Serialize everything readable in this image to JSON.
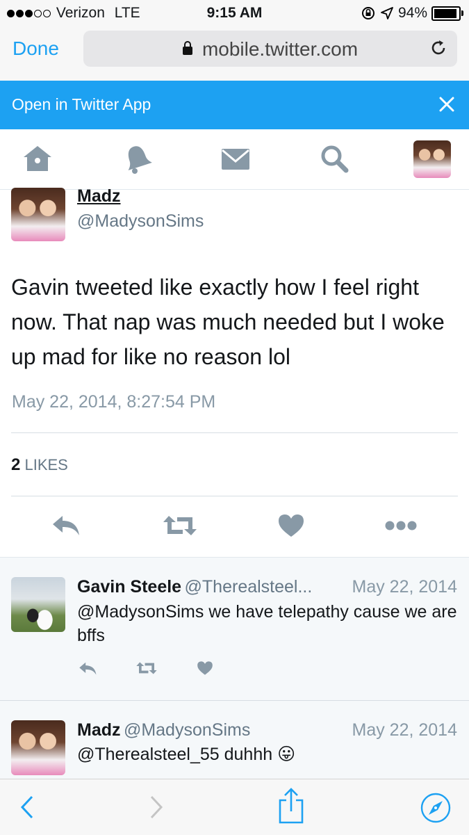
{
  "status_bar": {
    "carrier": "Verizon",
    "network": "LTE",
    "time": "9:15 AM",
    "battery": "94%",
    "battery_level": 0.94,
    "signal_bars": 3
  },
  "browser": {
    "done_label": "Done",
    "url": "mobile.twitter.com"
  },
  "banner": {
    "label": "Open in Twitter App"
  },
  "nav": {
    "items": [
      "home-icon",
      "notifications-icon",
      "messages-icon",
      "search-icon",
      "profile-avatar"
    ]
  },
  "main_tweet": {
    "name": "Madz",
    "handle": "@MadysonSims",
    "text": "Gavin tweeted like exactly how I feel right now. That nap was much needed but I woke up mad for like no reason lol",
    "timestamp": "May 22, 2014, 8:27:54 PM",
    "likes_count": "2",
    "likes_label": "LIKES"
  },
  "replies": [
    {
      "name": "Gavin Steele",
      "handle": "@Therealsteel...",
      "date": "May 22, 2014",
      "text": "@MadysonSims we have telepathy cause we are bffs"
    },
    {
      "name": "Madz",
      "handle": "@MadysonSims",
      "date": "May 22, 2014",
      "text": "@Therealsteel_55 duhhh 😛"
    }
  ],
  "colors": {
    "accent": "#1da1f2",
    "muted": "#8899a6",
    "text": "#14171a"
  }
}
